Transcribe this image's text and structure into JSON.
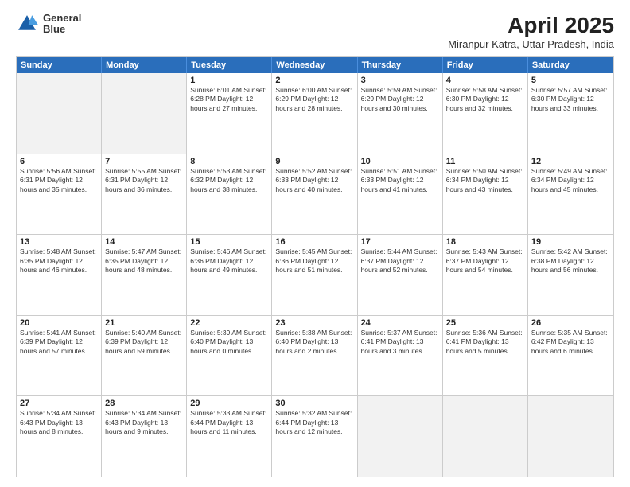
{
  "logo": {
    "line1": "General",
    "line2": "Blue"
  },
  "title": "April 2025",
  "subtitle": "Miranpur Katra, Uttar Pradesh, India",
  "header_days": [
    "Sunday",
    "Monday",
    "Tuesday",
    "Wednesday",
    "Thursday",
    "Friday",
    "Saturday"
  ],
  "rows": [
    [
      {
        "day": "",
        "info": "",
        "shaded": true
      },
      {
        "day": "",
        "info": "",
        "shaded": true
      },
      {
        "day": "1",
        "info": "Sunrise: 6:01 AM\nSunset: 6:28 PM\nDaylight: 12 hours and 27 minutes."
      },
      {
        "day": "2",
        "info": "Sunrise: 6:00 AM\nSunset: 6:29 PM\nDaylight: 12 hours and 28 minutes."
      },
      {
        "day": "3",
        "info": "Sunrise: 5:59 AM\nSunset: 6:29 PM\nDaylight: 12 hours and 30 minutes."
      },
      {
        "day": "4",
        "info": "Sunrise: 5:58 AM\nSunset: 6:30 PM\nDaylight: 12 hours and 32 minutes."
      },
      {
        "day": "5",
        "info": "Sunrise: 5:57 AM\nSunset: 6:30 PM\nDaylight: 12 hours and 33 minutes."
      }
    ],
    [
      {
        "day": "6",
        "info": "Sunrise: 5:56 AM\nSunset: 6:31 PM\nDaylight: 12 hours and 35 minutes."
      },
      {
        "day": "7",
        "info": "Sunrise: 5:55 AM\nSunset: 6:31 PM\nDaylight: 12 hours and 36 minutes."
      },
      {
        "day": "8",
        "info": "Sunrise: 5:53 AM\nSunset: 6:32 PM\nDaylight: 12 hours and 38 minutes."
      },
      {
        "day": "9",
        "info": "Sunrise: 5:52 AM\nSunset: 6:33 PM\nDaylight: 12 hours and 40 minutes."
      },
      {
        "day": "10",
        "info": "Sunrise: 5:51 AM\nSunset: 6:33 PM\nDaylight: 12 hours and 41 minutes."
      },
      {
        "day": "11",
        "info": "Sunrise: 5:50 AM\nSunset: 6:34 PM\nDaylight: 12 hours and 43 minutes."
      },
      {
        "day": "12",
        "info": "Sunrise: 5:49 AM\nSunset: 6:34 PM\nDaylight: 12 hours and 45 minutes."
      }
    ],
    [
      {
        "day": "13",
        "info": "Sunrise: 5:48 AM\nSunset: 6:35 PM\nDaylight: 12 hours and 46 minutes."
      },
      {
        "day": "14",
        "info": "Sunrise: 5:47 AM\nSunset: 6:35 PM\nDaylight: 12 hours and 48 minutes."
      },
      {
        "day": "15",
        "info": "Sunrise: 5:46 AM\nSunset: 6:36 PM\nDaylight: 12 hours and 49 minutes."
      },
      {
        "day": "16",
        "info": "Sunrise: 5:45 AM\nSunset: 6:36 PM\nDaylight: 12 hours and 51 minutes."
      },
      {
        "day": "17",
        "info": "Sunrise: 5:44 AM\nSunset: 6:37 PM\nDaylight: 12 hours and 52 minutes."
      },
      {
        "day": "18",
        "info": "Sunrise: 5:43 AM\nSunset: 6:37 PM\nDaylight: 12 hours and 54 minutes."
      },
      {
        "day": "19",
        "info": "Sunrise: 5:42 AM\nSunset: 6:38 PM\nDaylight: 12 hours and 56 minutes."
      }
    ],
    [
      {
        "day": "20",
        "info": "Sunrise: 5:41 AM\nSunset: 6:39 PM\nDaylight: 12 hours and 57 minutes."
      },
      {
        "day": "21",
        "info": "Sunrise: 5:40 AM\nSunset: 6:39 PM\nDaylight: 12 hours and 59 minutes."
      },
      {
        "day": "22",
        "info": "Sunrise: 5:39 AM\nSunset: 6:40 PM\nDaylight: 13 hours and 0 minutes."
      },
      {
        "day": "23",
        "info": "Sunrise: 5:38 AM\nSunset: 6:40 PM\nDaylight: 13 hours and 2 minutes."
      },
      {
        "day": "24",
        "info": "Sunrise: 5:37 AM\nSunset: 6:41 PM\nDaylight: 13 hours and 3 minutes."
      },
      {
        "day": "25",
        "info": "Sunrise: 5:36 AM\nSunset: 6:41 PM\nDaylight: 13 hours and 5 minutes."
      },
      {
        "day": "26",
        "info": "Sunrise: 5:35 AM\nSunset: 6:42 PM\nDaylight: 13 hours and 6 minutes."
      }
    ],
    [
      {
        "day": "27",
        "info": "Sunrise: 5:34 AM\nSunset: 6:43 PM\nDaylight: 13 hours and 8 minutes."
      },
      {
        "day": "28",
        "info": "Sunrise: 5:34 AM\nSunset: 6:43 PM\nDaylight: 13 hours and 9 minutes."
      },
      {
        "day": "29",
        "info": "Sunrise: 5:33 AM\nSunset: 6:44 PM\nDaylight: 13 hours and 11 minutes."
      },
      {
        "day": "30",
        "info": "Sunrise: 5:32 AM\nSunset: 6:44 PM\nDaylight: 13 hours and 12 minutes."
      },
      {
        "day": "",
        "info": "",
        "shaded": true
      },
      {
        "day": "",
        "info": "",
        "shaded": true
      },
      {
        "day": "",
        "info": "",
        "shaded": true
      }
    ]
  ]
}
